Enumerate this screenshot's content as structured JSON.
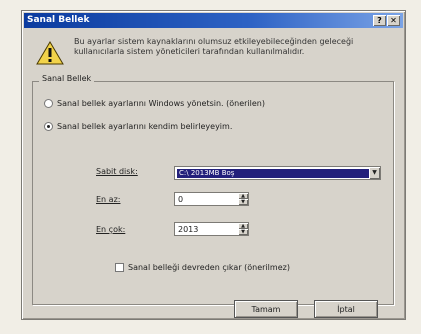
{
  "window": {
    "title": "Sanal Bellek",
    "help_symbol": "?",
    "close_symbol": "✕"
  },
  "intro_text": "Bu ayarlar sistem kaynaklarını olumsuz etkileyebileceğinden geleceği kullanıcılarla sistem yöneticileri tarafından kullanılmalıdır.",
  "group": {
    "label": "Sanal Bellek",
    "radio_windows": "Sanal bellek ayarlarını Windows yönetsin. (önerilen)",
    "radio_custom": "Sanal bellek ayarlarını kendim belirleyeyim."
  },
  "fields": {
    "disk_label": "Sabit disk:",
    "disk_value": "C:\\ 2013MB Boş",
    "min_label": "En az:",
    "min_value": "0",
    "max_label": "En çok:",
    "max_value": "2013"
  },
  "checkbox_label": "Sanal belleği devreden çıkar (önerilmez)",
  "buttons": {
    "ok": "Tamam",
    "cancel": "İptal"
  }
}
